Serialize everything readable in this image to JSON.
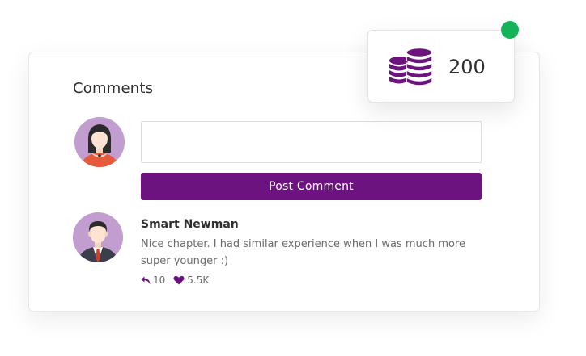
{
  "comments": {
    "title": "Comments",
    "input": {
      "value": "",
      "placeholder": ""
    },
    "post_button_label": "Post Comment",
    "items": [
      {
        "author": "Smart Newman",
        "text": "Nice chapter. I had similar experience when I was much more super younger :)",
        "replies": "10",
        "likes": "5.5K"
      }
    ]
  },
  "coins": {
    "value": "200",
    "icon": "coins-stack-icon",
    "status": "online"
  },
  "colors": {
    "accent": "#6c1380",
    "status_online": "#15b359",
    "avatar_bg": "#c29dd0"
  }
}
